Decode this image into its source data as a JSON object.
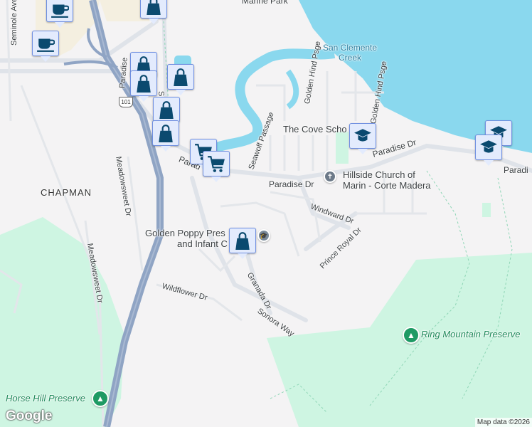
{
  "map": {
    "colors": {
      "water": "#8ad8ee",
      "park": "#cef5e2",
      "land": "#f4f3f4",
      "road": "#dfe3e9",
      "highway": "#8fa4c4",
      "commercial": "#f4efe0",
      "marker_bg": "#e3ebfd",
      "marker_icon": "#0b4a6f"
    },
    "labels": {
      "marine_park": "Marine Park",
      "san_clemente_creek_1": "San Clemente",
      "san_clemente_creek_2": "Creek",
      "golden_hind_1": "Golden Hind Psge",
      "golden_hind_2": "Golden Hind Psge",
      "cove_school": "The Cove Scho",
      "paradise_dr_1": "Paradise Dr",
      "paradise_dr_2": "Paradise Dr",
      "paradise_dr_3": "Parad",
      "paradise_dr_4": "Paradi",
      "paradise_left": "Paradise",
      "church_1": "Hillside Church of",
      "church_2": "Marin - Corte Madera",
      "windward": "Windward Dr",
      "prince_royal": "Prince Royal Dr",
      "seawolf": "Seawolf Passage",
      "chapman": "CHAPMAN",
      "meadowsweet_1": "Meadowsweet Dr",
      "meadowsweet_2": "Meadowsweet Dr",
      "golden_poppy_1": "Golden Poppy Pres",
      "golden_poppy_2": "and Infant C",
      "granada": "Granada Dr",
      "sonora": "Sonora Way",
      "wildflower": "Wildflower Dr",
      "ring_mountain": "Ring Mountain Preserve",
      "horse_hill": "Horse Hill Preserve",
      "seminole": "Seminole Ave",
      "san_clem_st": "San Clem",
      "highway_shield": "101"
    },
    "attribution": "Map data ©2026",
    "logo": "Google"
  }
}
